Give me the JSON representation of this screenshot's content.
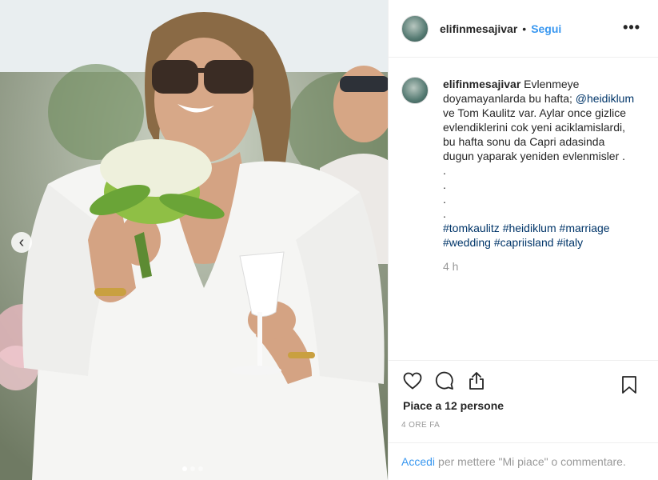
{
  "post": {
    "username": "elifinmesajivar",
    "separator": "•",
    "follow_label": "Segui",
    "more_label": "•••"
  },
  "caption": {
    "username": "elifinmesajivar",
    "text_1": "Evlenmeye doyamayanlarda bu hafta; ",
    "mention": "@heidiklum",
    "text_2": "ve Tom Kaulitz var. Aylar once gizlice evlendiklerini cok yeni aciklamislardi, bu hafta sonu da Capri adasinda dugun yaparak yeniden evlenmisler .",
    "dots": [
      ".",
      ".",
      ".",
      "."
    ],
    "hashtags": [
      "#tomkaulitz",
      "#heidiklum",
      "#marriage",
      "#wedding",
      "#capriisland",
      "#italy"
    ],
    "time": "4 h"
  },
  "actions": {
    "like_icon": "heart-icon",
    "comment_icon": "comment-icon",
    "share_icon": "share-icon",
    "save_icon": "bookmark-icon"
  },
  "likes_text": "Piace a 12 persone",
  "time_ago": "4 ORE FA",
  "footer": {
    "login": "Accedi",
    "rest": "per mettere \"Mi piace\" o commentare."
  },
  "media": {
    "prev_icon": "chevron-left-icon",
    "carousel_count": 3,
    "carousel_active": 0
  },
  "colors": {
    "link": "#3897f0",
    "mention": "#003569",
    "muted": "#999999",
    "text": "#262626"
  }
}
